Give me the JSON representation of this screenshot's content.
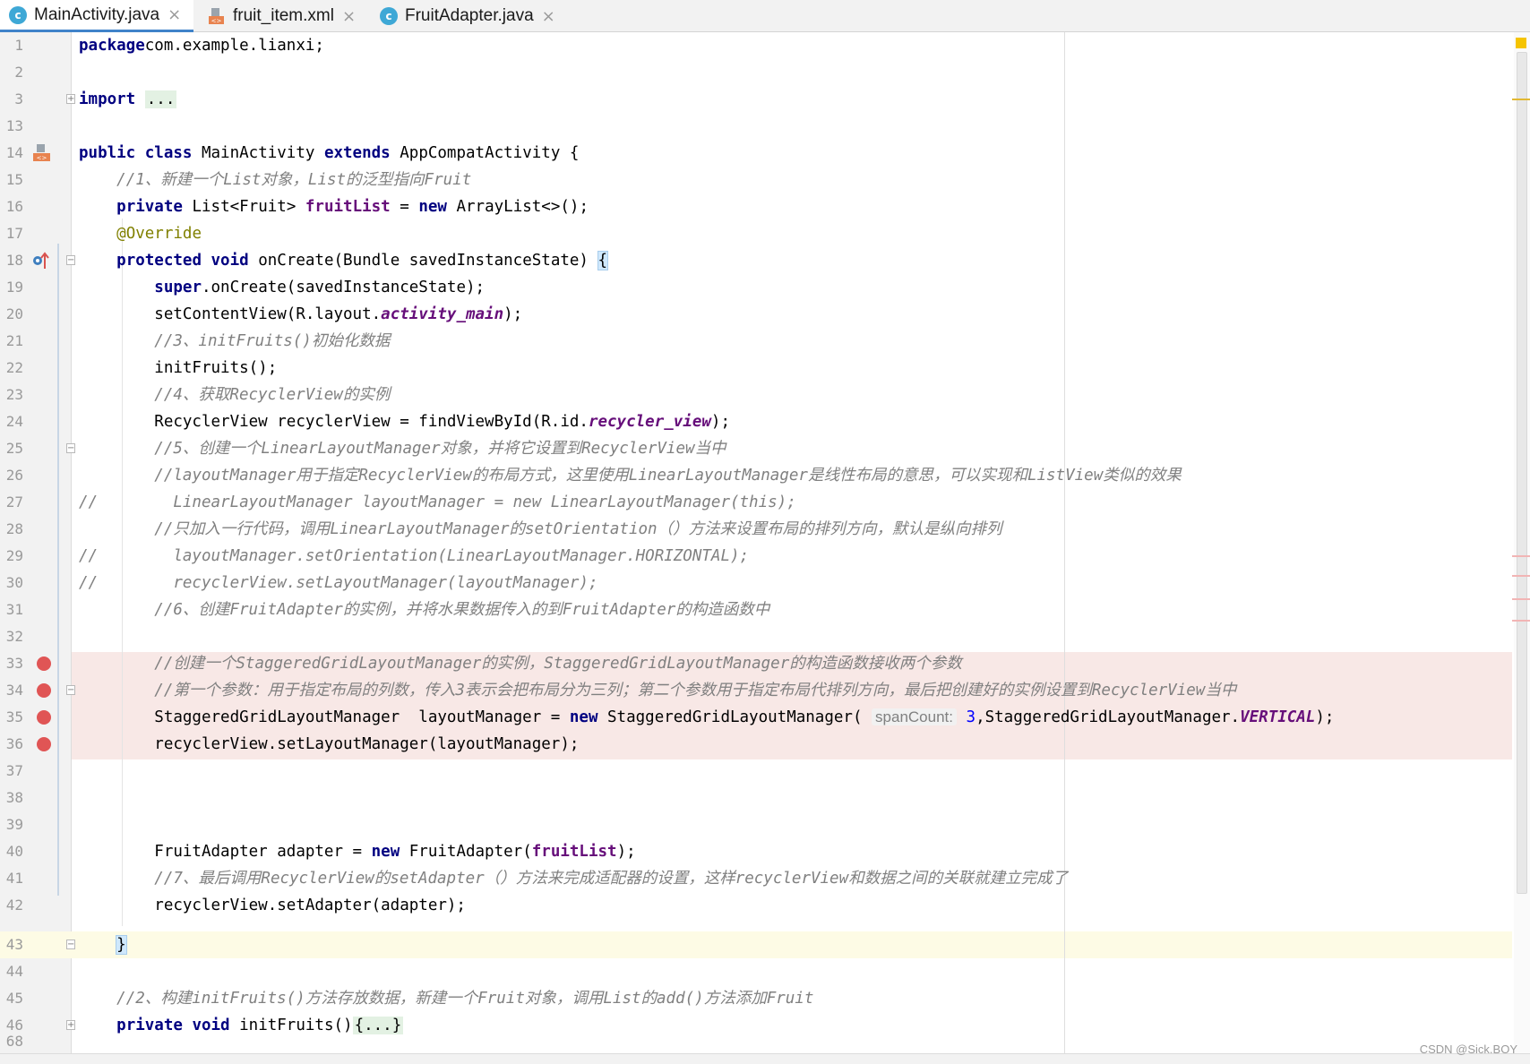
{
  "tabs": [
    {
      "label": "MainActivity.java",
      "icon": "java-class-icon",
      "active": true
    },
    {
      "label": "fruit_item.xml",
      "icon": "xml-layout-icon",
      "active": false
    },
    {
      "label": "FruitAdapter.java",
      "icon": "java-class-icon",
      "active": false
    }
  ],
  "editor": {
    "lines": {
      "l1": {
        "n": "1",
        "t": [
          [
            "kw",
            "package"
          ],
          [
            "",
            "com.example.lianxi;"
          ]
        ]
      },
      "l2": {
        "n": "2",
        "t": []
      },
      "l3": {
        "n": "3",
        "t": [
          [
            "kw",
            "import"
          ],
          [
            "",
            " "
          ],
          [
            "fold",
            "..."
          ]
        ]
      },
      "l13": {
        "n": "13",
        "t": []
      },
      "l14": {
        "n": "14",
        "t": [
          [
            "kw",
            "public class"
          ],
          [
            "",
            " MainActivity "
          ],
          [
            "kw",
            "extends"
          ],
          [
            "",
            " AppCompatActivity {"
          ]
        ]
      },
      "l15": {
        "n": "15",
        "t": [
          [
            "",
            "    "
          ],
          [
            "cmt",
            "//1、新建一个List对象，List的泛型指向Fruit"
          ]
        ]
      },
      "l16": {
        "n": "16",
        "t": [
          [
            "",
            "    "
          ],
          [
            "kw",
            "private"
          ],
          [
            "",
            " List<Fruit> "
          ],
          [
            "field",
            "fruitList"
          ],
          [
            "",
            " = "
          ],
          [
            "kw",
            "new"
          ],
          [
            "",
            " ArrayList<>();"
          ]
        ]
      },
      "l17": {
        "n": "17",
        "t": [
          [
            "",
            "    "
          ],
          [
            "anno",
            "@Override"
          ]
        ]
      },
      "l18": {
        "n": "18",
        "t": [
          [
            "",
            "    "
          ],
          [
            "kw",
            "protected void"
          ],
          [
            "",
            " onCreate(Bundle savedInstanceState) "
          ],
          [
            "brace",
            "{"
          ]
        ]
      },
      "l19": {
        "n": "19",
        "t": [
          [
            "",
            "        "
          ],
          [
            "kw",
            "super"
          ],
          [
            "",
            ".onCreate(savedInstanceState);"
          ]
        ]
      },
      "l20": {
        "n": "20",
        "t": [
          [
            "",
            "        setContentView(R.layout."
          ],
          [
            "stat",
            "activity_main"
          ],
          [
            "",
            ");"
          ]
        ]
      },
      "l21": {
        "n": "21",
        "t": [
          [
            "",
            "        "
          ],
          [
            "cmt",
            "//3、initFruits()初始化数据"
          ]
        ]
      },
      "l22": {
        "n": "22",
        "t": [
          [
            "",
            "        initFruits();"
          ]
        ]
      },
      "l23": {
        "n": "23",
        "t": [
          [
            "",
            "        "
          ],
          [
            "cmt",
            "//4、获取RecyclerView的实例"
          ]
        ]
      },
      "l24": {
        "n": "24",
        "t": [
          [
            "",
            "        RecyclerView recyclerView = findViewById(R.id."
          ],
          [
            "stat",
            "recycler_view"
          ],
          [
            "",
            ");"
          ]
        ]
      },
      "l25": {
        "n": "25",
        "t": [
          [
            "",
            "        "
          ],
          [
            "cmt",
            "//5、创建一个LinearLayoutManager对象，并将它设置到RecyclerView当中"
          ]
        ]
      },
      "l26": {
        "n": "26",
        "t": [
          [
            "",
            "        "
          ],
          [
            "cmt",
            "//layoutManager用于指定RecyclerView的布局方式，这里使用LinearLayoutManager是线性布局的意思，可以实现和ListView类似的效果"
          ]
        ]
      },
      "l27": {
        "n": "27",
        "t": [
          [
            "cmt",
            "//        LinearLayoutManager layoutManager = new LinearLayoutManager(this);"
          ]
        ]
      },
      "l28": {
        "n": "28",
        "t": [
          [
            "",
            "        "
          ],
          [
            "cmt",
            "//只加入一行代码，调用LinearLayoutManager的setOrientation（）方法来设置布局的排列方向，默认是纵向排列"
          ]
        ]
      },
      "l29": {
        "n": "29",
        "t": [
          [
            "cmt",
            "//        layoutManager.setOrientation(LinearLayoutManager.HORIZONTAL);"
          ]
        ]
      },
      "l30": {
        "n": "30",
        "t": [
          [
            "cmt",
            "//        recyclerView.setLayoutManager(layoutManager);"
          ]
        ]
      },
      "l31": {
        "n": "31",
        "t": [
          [
            "",
            "        "
          ],
          [
            "cmt",
            "//6、创建FruitAdapter的实例，并将水果数据传入的到FruitAdapter的构造函数中"
          ]
        ]
      },
      "l32": {
        "n": "32",
        "t": []
      },
      "l33": {
        "n": "33",
        "t": [
          [
            "",
            "        "
          ],
          [
            "cmt",
            "//创建一个StaggeredGridLayoutManager的实例，StaggeredGridLayoutManager的构造函数接收两个参数"
          ]
        ]
      },
      "l34": {
        "n": "34",
        "t": [
          [
            "",
            "        "
          ],
          [
            "cmt",
            "//第一个参数：用于指定布局的列数，传入3表示会把布局分为三列；第二个参数用于指定布局代排列方向，最后把创建好的实例设置到RecyclerView当中"
          ]
        ]
      },
      "l35": {
        "n": "35",
        "t": [
          [
            "",
            "        StaggeredGridLayoutManager  layoutManager = "
          ],
          [
            "kw",
            "new"
          ],
          [
            "",
            " StaggeredGridLayoutManager( "
          ],
          [
            "hint",
            "spanCount:"
          ],
          [
            "",
            " "
          ],
          [
            "num",
            "3"
          ],
          [
            "",
            ",StaggeredGridLayoutManager."
          ],
          [
            "stat",
            "VERTICAL"
          ],
          [
            "",
            ");"
          ]
        ]
      },
      "l36": {
        "n": "36",
        "t": [
          [
            "",
            "        recyclerView.setLayoutManager(layoutManager);"
          ]
        ]
      },
      "l37": {
        "n": "37",
        "t": []
      },
      "l38": {
        "n": "38",
        "t": []
      },
      "l39": {
        "n": "39",
        "t": []
      },
      "l40": {
        "n": "40",
        "t": [
          [
            "",
            "        FruitAdapter adapter = "
          ],
          [
            "kw",
            "new"
          ],
          [
            "",
            " FruitAdapter("
          ],
          [
            "field",
            "fruitList"
          ],
          [
            "",
            ");"
          ]
        ]
      },
      "l41": {
        "n": "41",
        "t": [
          [
            "",
            "        "
          ],
          [
            "cmt",
            "//7、最后调用RecyclerView的setAdapter（）方法来完成适配器的设置，这样recyclerView和数据之间的关联就建立完成了"
          ]
        ]
      },
      "l42": {
        "n": "42",
        "t": [
          [
            "",
            "        recyclerView.setAdapter(adapter);"
          ]
        ]
      },
      "l43": {
        "n": "43",
        "t": [
          [
            "",
            "    "
          ],
          [
            "brace",
            "}"
          ]
        ]
      },
      "l44": {
        "n": "44",
        "t": []
      },
      "l45": {
        "n": "45",
        "t": [
          [
            "",
            "    "
          ],
          [
            "cmt",
            "//2、构建initFruits()方法存放数据，新建一个Fruit对象，调用List的add()方法添加Fruit"
          ]
        ]
      },
      "l46": {
        "n": "46",
        "t": [
          [
            "",
            "    "
          ],
          [
            "kw",
            "private void"
          ],
          [
            "",
            " initFruits()"
          ],
          [
            "fold",
            "{...}"
          ]
        ]
      },
      "l68": {
        "n": "68",
        "t": []
      }
    }
  },
  "colors": {
    "keyword": "#000080",
    "field": "#660e7a",
    "comment": "#808080",
    "annotation": "#808000",
    "number": "#0000ff",
    "breakpoint": "#e05555",
    "breakpoint_line": "#f8e8e6",
    "caret_line": "#fdfbe5",
    "tab_underline": "#4083c9"
  },
  "watermark": "CSDN @Sick.BOY"
}
